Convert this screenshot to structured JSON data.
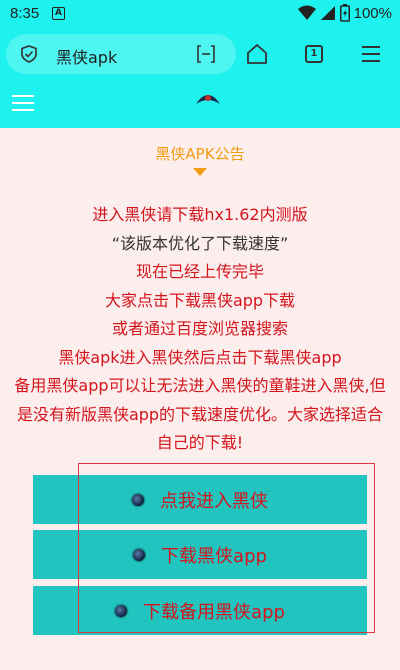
{
  "status": {
    "time": "8:35",
    "notif_letter": "A",
    "battery": "100%"
  },
  "browser": {
    "url_text": "黑侠apk",
    "tab_count": "1"
  },
  "notice": {
    "title": "黑侠APK公告"
  },
  "announcement": {
    "line1": "进入黑侠请下载hx1.62内测版",
    "line2": "“该版本优化了下载速度”",
    "line3": "现在已经上传完毕",
    "line4": "大家点击下载黑侠app下载",
    "line5": "或者通过百度浏览器搜索",
    "line6": "黑侠apk进入黑侠然后点击下载黑侠app",
    "line7": "备用黑侠app可以让无法进入黑侠的童鞋进入黑侠,但是没有新版黑侠app的下载速度优化。大家选择适合自己的下载!"
  },
  "buttons": {
    "enter": "点我进入黑侠",
    "download": "下载黑侠app",
    "download_backup": "下载备用黑侠app"
  },
  "colors": {
    "toolbar": "#1ef2ee",
    "page_bg": "#fdeeee",
    "button_bg": "#22c4bf",
    "text_red": "#d4141c",
    "notice_orange": "#f39c12"
  }
}
